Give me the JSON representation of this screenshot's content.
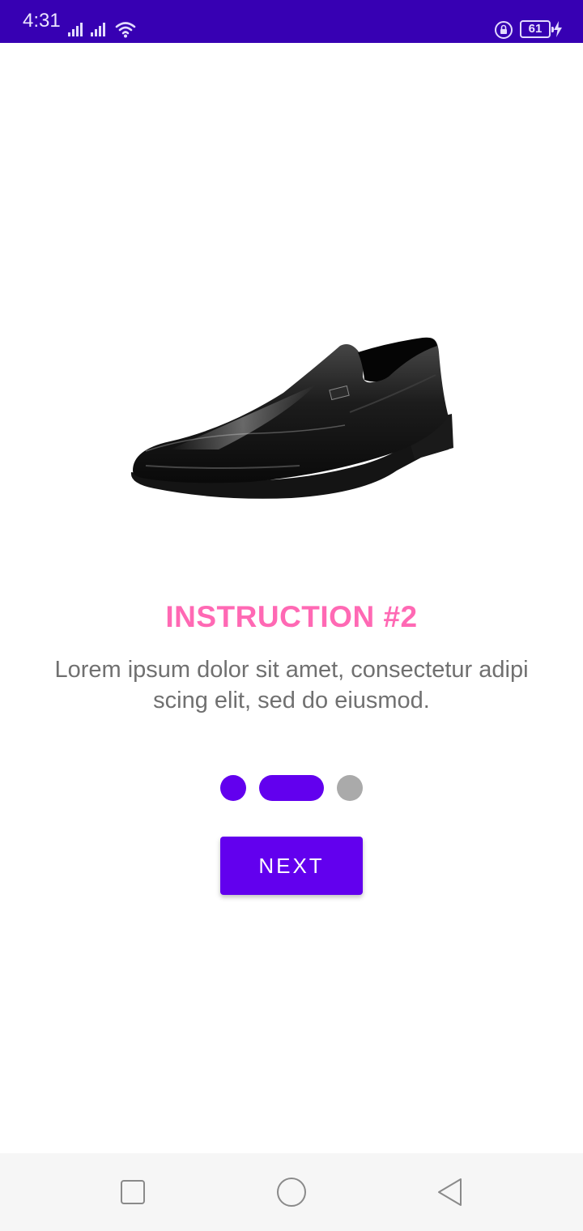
{
  "status_bar": {
    "time": "4:31",
    "battery_level": "61",
    "background_color": "#3700b3",
    "icons": [
      "signal-icon",
      "signal-icon",
      "wifi-icon",
      "rotation-lock-icon",
      "battery-icon",
      "charging-bolt-icon"
    ]
  },
  "onboarding": {
    "image": "black-leather-loafer-shoe",
    "title": "INSTRUCTION #2",
    "description": "Lorem ipsum dolor sit amet, consectetur adipi scing elit, sed do eiusmod.",
    "page_indicator": {
      "total_pages": 3,
      "current_page": 2,
      "active_color": "#6200ee",
      "inactive_color": "#aaaaaa"
    },
    "next_button_label": "NEXT"
  },
  "colors": {
    "title": "#ff69b4",
    "accent": "#6200ee",
    "description_text": "#707070"
  },
  "nav_bar": {
    "buttons": [
      "recents-icon",
      "home-icon",
      "back-icon"
    ]
  }
}
